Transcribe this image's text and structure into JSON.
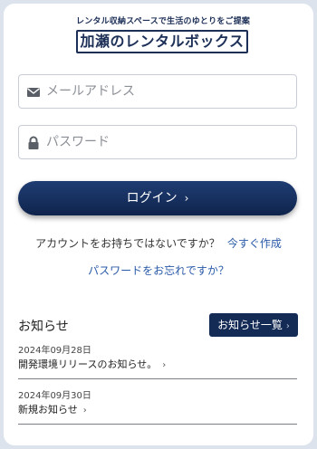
{
  "logo": {
    "tagline": "レンタル収納スペースで生活のゆとりをご提案",
    "name": "加瀬のレンタルボックス"
  },
  "form": {
    "email_placeholder": "メールアドレス",
    "password_placeholder": "パスワード",
    "email_icon": "envelope-icon",
    "password_icon": "lock-icon",
    "login_label": "ログイン",
    "login_chevron": "›"
  },
  "links": {
    "no_account_text": "アカウントをお持ちではないですか？",
    "signup_link": "今すぐ作成",
    "forgot_password": "パスワードをお忘れですか？"
  },
  "news": {
    "title": "お知らせ",
    "all_button": "お知らせ一覧",
    "items": [
      {
        "date": "2024年09月28日",
        "text": "開発環境リリースのお知らせ。"
      },
      {
        "date": "2024年09月30日",
        "text": "新規お知らせ"
      }
    ]
  },
  "colors": {
    "brand": "#1c2f57",
    "primary_button": "#142b55",
    "link": "#2a5aa8",
    "background": "#dde3ec"
  }
}
